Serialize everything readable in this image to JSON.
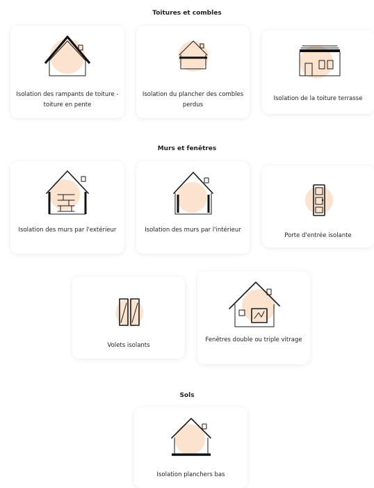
{
  "sections": [
    {
      "title": "Toitures et combles",
      "cards": [
        {
          "label": "Isolation des rampants de toiture - toiture en pente",
          "icon": "roof-slope-house-icon"
        },
        {
          "label": "Isolation du plancher des combles perdus",
          "icon": "attic-floor-house-icon"
        },
        {
          "label": "Isolation de la toiture terrasse",
          "icon": "flat-roof-building-icon"
        }
      ]
    },
    {
      "title": "Murs et fenêtres",
      "cards": [
        {
          "label": "Isolation des murs par l'extérieur",
          "icon": "exterior-wall-house-icon"
        },
        {
          "label": "Isolation des murs par l'intérieur",
          "icon": "interior-wall-house-icon"
        },
        {
          "label": "Porte d'entrée isolante",
          "icon": "door-icon"
        },
        {
          "label": "Volets isolants",
          "icon": "shutters-icon"
        },
        {
          "label": "Fenêtres double ou triple vitrage",
          "icon": "window-house-icon"
        }
      ]
    },
    {
      "title": "Sols",
      "cards": [
        {
          "label": "Isolation planchers bas",
          "icon": "low-floor-house-icon"
        }
      ]
    }
  ],
  "colors": {
    "accent_blob": "#fbe3d0",
    "text": "#1f1f1f",
    "card_bg": "#ffffff"
  }
}
